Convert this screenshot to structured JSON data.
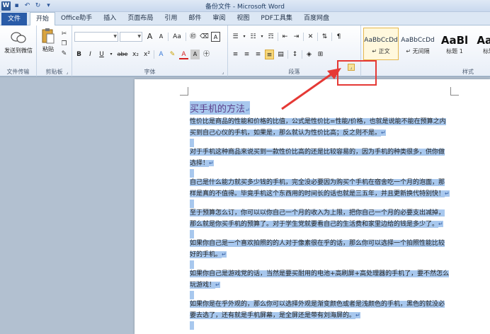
{
  "window": {
    "title": "备份文件 - Microsoft Word",
    "logo": "W"
  },
  "tabs": {
    "file": "文件",
    "items": [
      "开始",
      "Office助手",
      "插入",
      "页面布局",
      "引用",
      "邮件",
      "审阅",
      "视图",
      "PDF工具集",
      "百度网盘"
    ],
    "active_index": 0
  },
  "ribbon": {
    "wechat": {
      "button": "发送到微信",
      "group": "文件传输"
    },
    "clipboard": {
      "paste": "粘贴",
      "group": "剪贴板"
    },
    "font": {
      "group": "字体",
      "grow": "A",
      "shrink": "A",
      "case": "Aa",
      "bold": "B",
      "italic": "I",
      "underline": "U",
      "strike": "abe",
      "sub": "x₂",
      "sup": "x²",
      "color_a": "A",
      "char_a": "A",
      "encircle": "㊉"
    },
    "paragraph": {
      "group": "段落"
    },
    "styles": {
      "group": "样式",
      "cards": [
        {
          "sample": "AaBbCcDd",
          "name": "↵ 正文",
          "selected": true,
          "big": false
        },
        {
          "sample": "AaBbCcDd",
          "name": "↵ 无间隔",
          "selected": false,
          "big": false
        },
        {
          "sample": "AaBl",
          "name": "标题 1",
          "selected": false,
          "big": true
        },
        {
          "sample": "AaB",
          "name": "标题",
          "selected": false,
          "big": true
        }
      ]
    }
  },
  "document": {
    "title": "买手机的方法",
    "paragraphs": [
      "性价比是商品的性能和价格的比值，公式是性价比=性能/价格，也就是说能不能在预算之内买到自己心仪的手机，如果是，那么就认为性价比高；反之则不是。",
      "对于手机这种商品来说买到一款性价比高的还是比较容易的，因为手机的种类很多，供你做选择！",
      "自己是什么能力就买多少钱的手机，完全没必要因为购买个手机在宿舍吃一个月的泡面，那样是真的不值得。毕竟手机这个东西用的时间长的话也就是三五年，并且更新换代特别快！",
      "至于预算怎么订，你可以以你自己一个月的收入为上限，把你自己一个月的必要支出减掉，那么就是你买手机的预算了。对于学生党就要看自己的生活费和家里边给的钱是多少了。",
      "如果你自己是一个喜欢拍照的的人对于像素很在乎的话，那么你可以选择一个拍照性能比较好的手机。",
      "如果你自己是游戏党的话，当然是要买耐用的电池+高刷屏+高处理器的手机了，要不然怎么玩游戏！",
      "如果你是在乎外观的，那么你可以选择外观是渐变颜色或者是浅颜色的手机，黑色的就没必要去选了，还有就是手机屏幕，是全屏还是带有刘海屏的。"
    ]
  },
  "colors": {
    "selection": "#a8c8ee",
    "file_tab": "#2a5ca8",
    "annotation": "#e53935"
  }
}
